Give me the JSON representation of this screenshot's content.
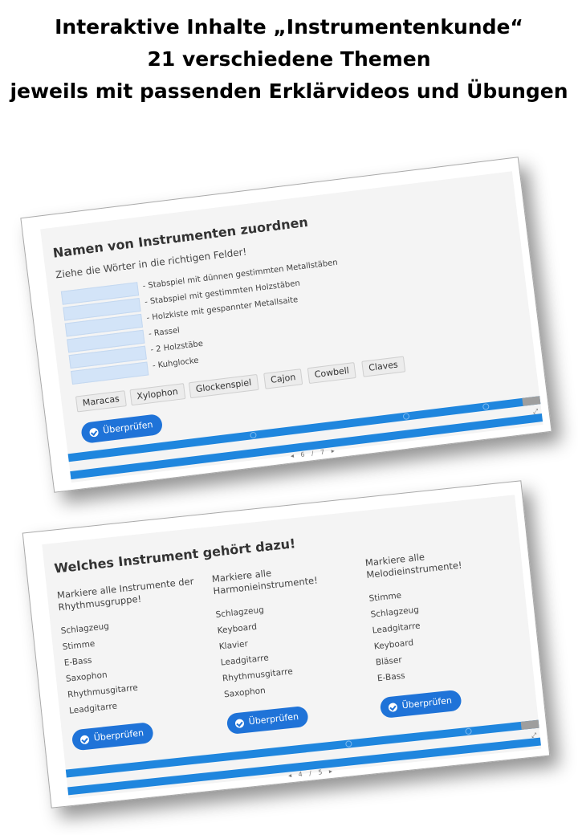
{
  "header": {
    "line1": "Interaktive Inhalte „Instrumentenkunde“",
    "line2": "21 verschiedene Themen",
    "line3": "jeweils mit passenden Erklärvideos und Übungen"
  },
  "card1": {
    "title": "Namen von Instrumenten zuordnen",
    "instruction": "Ziehe die Wörter in die richtigen Felder!",
    "descriptions": [
      "- Stabspiel mit dünnen gestimmten Metallstäben",
      "- Stabspiel mit gestimmten Holzstäben",
      "- Holzkiste mit gespannter Metallsaite",
      "- Rassel",
      "- 2 Holzstäbe",
      "- Kuhglocke"
    ],
    "words": [
      "Maracas",
      "Xylophon",
      "Glockenspiel",
      "Cajon",
      "Cowbell",
      "Claves"
    ],
    "check_label": "Überprüfen",
    "pager": "◂ 6 / 7 ▸"
  },
  "card2": {
    "title": "Welches Instrument gehört dazu!",
    "columns": [
      {
        "heading": "Markiere alle Instrumente der Rhythmusgruppe!",
        "items": [
          "Schlagzeug",
          "Stimme",
          "E-Bass",
          "Saxophon",
          "Rhythmusgitarre",
          "Leadgitarre"
        ],
        "check_label": "Überprüfen"
      },
      {
        "heading": "Markiere alle Harmonieinstrumente!",
        "items": [
          "Schlagzeug",
          "Keyboard",
          "Klavier",
          "Leadgitarre",
          "Rhythmusgitarre",
          "Saxophon"
        ],
        "check_label": "Überprüfen"
      },
      {
        "heading": "Markiere alle Melodieinstrumente!",
        "items": [
          "Stimme",
          "Schlagzeug",
          "Leadgitarre",
          "Keyboard",
          "Bläser",
          "E-Bass"
        ],
        "check_label": "Überprüfen"
      }
    ],
    "pager": "◂ 4 / 5 ▸"
  },
  "icons": {
    "check": "check-circle-icon",
    "fullscreen": "fullscreen-icon"
  },
  "colors": {
    "accent": "#1f73d8",
    "progress": "#1f86de",
    "dropzone": "#d3e4f8"
  }
}
